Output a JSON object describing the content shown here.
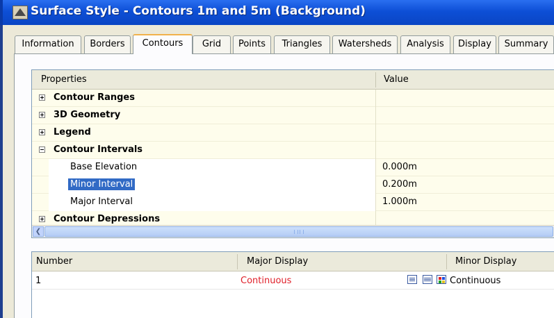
{
  "window": {
    "title": "Surface Style - Contours 1m and 5m (Background)"
  },
  "tabs": [
    {
      "label": "Information"
    },
    {
      "label": "Borders"
    },
    {
      "label": "Contours",
      "active": true
    },
    {
      "label": "Grid"
    },
    {
      "label": "Points"
    },
    {
      "label": "Triangles"
    },
    {
      "label": "Watersheds"
    },
    {
      "label": "Analysis"
    },
    {
      "label": "Display"
    },
    {
      "label": "Summary"
    }
  ],
  "properties": {
    "header_name": "Properties",
    "header_value": "Value",
    "rows": [
      {
        "label": "Contour Ranges",
        "type": "group",
        "expanded": false
      },
      {
        "label": "3D Geometry",
        "type": "group",
        "expanded": false
      },
      {
        "label": "Legend",
        "type": "group",
        "expanded": false
      },
      {
        "label": "Contour Intervals",
        "type": "group",
        "expanded": true
      },
      {
        "label": "Base Elevation",
        "type": "child",
        "value": "0.000m"
      },
      {
        "label": "Minor Interval",
        "type": "child",
        "value": "0.200m",
        "selected": true
      },
      {
        "label": "Major Interval",
        "type": "child",
        "value": "1.000m"
      },
      {
        "label": "Contour Depressions",
        "type": "group",
        "expanded": false,
        "partially_hidden": true
      }
    ]
  },
  "table": {
    "headers": {
      "number": "Number",
      "major": "Major Display",
      "minor": "Minor Display"
    },
    "rows": [
      {
        "number": "1",
        "major": "Continuous",
        "minor": "Continuous"
      }
    ]
  },
  "colors": {
    "title_bar": "#0d4fd6",
    "selection": "#316ac5",
    "major_display_text": "#e0202a",
    "active_tab_accent": "#f1b24b"
  },
  "icons": [
    "app-icon",
    "expand-icon",
    "collapse-icon",
    "scroll-left-arrow-icon",
    "linetype-icon",
    "lineweight-icon",
    "color-icon"
  ]
}
